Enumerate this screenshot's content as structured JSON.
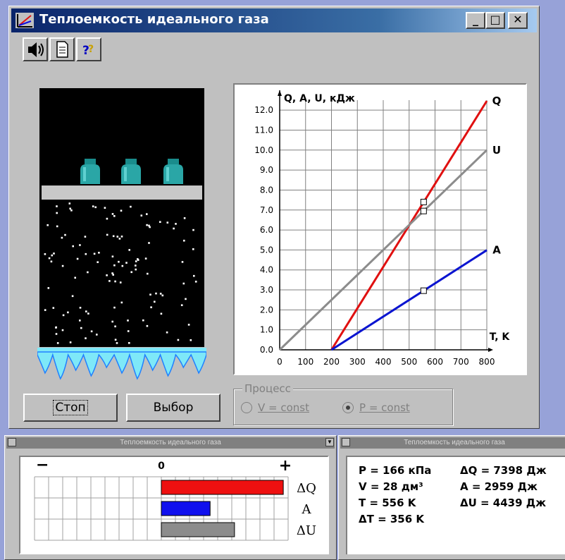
{
  "window": {
    "title": "Теплоемкость идеального газа",
    "minimize_label": "_",
    "maximize_label": "□",
    "close_label": "✕"
  },
  "toolbar": {
    "help_label": "?"
  },
  "buttons": {
    "stop_label": "Стоп",
    "select_label": "Выбор"
  },
  "process": {
    "group_label": "Процесс",
    "option_v": "V = const",
    "option_p": "P = const",
    "selected": "P = const"
  },
  "chart_data": {
    "type": "line",
    "ylabel": "Q, A, U, кДж",
    "xlabel": "T, K",
    "xlim": [
      0,
      800
    ],
    "ylim": [
      0,
      12.5
    ],
    "x_ticks": [
      "0",
      "100",
      "200",
      "300",
      "400",
      "500",
      "600",
      "700",
      "800"
    ],
    "y_ticks": [
      "0.0",
      "1.0",
      "2.0",
      "3.0",
      "4.0",
      "5.0",
      "6.0",
      "7.0",
      "8.0",
      "9.0",
      "10.0",
      "11.0",
      "12.0"
    ],
    "grid": true,
    "series": [
      {
        "name": "Q",
        "color": "#e01010",
        "points": [
          [
            200,
            0
          ],
          [
            800,
            12.46
          ]
        ]
      },
      {
        "name": "U",
        "color": "#8c8c8c",
        "points": [
          [
            0,
            0
          ],
          [
            800,
            10.0
          ]
        ]
      },
      {
        "name": "A",
        "color": "#0a14d0",
        "points": [
          [
            200,
            0
          ],
          [
            800,
            4.99
          ]
        ]
      }
    ],
    "markers": [
      {
        "series": "Q",
        "x": 556,
        "y": 7.4
      },
      {
        "series": "U",
        "x": 556,
        "y": 6.95
      },
      {
        "series": "A",
        "x": 556,
        "y": 2.96
      }
    ]
  },
  "bar_window": {
    "title": "Теплоемкость идеального газа",
    "minus_label": "−",
    "zero_label": "0",
    "plus_label": "+",
    "colors": {
      "dQ": "#ee1010",
      "A": "#1010ee",
      "dU": "#8c8c8c"
    },
    "bars": [
      {
        "label": "ΔQ",
        "value": 7398
      },
      {
        "label": "A",
        "value": 2959
      },
      {
        "label": "ΔU",
        "value": 4439
      }
    ],
    "scale_max": 10000
  },
  "stats_window": {
    "title": "Теплоемкость идеального газа",
    "rows": [
      {
        "left": "P  = 166 кПа",
        "right": "ΔQ = 7398 Дж"
      },
      {
        "left": "V  = 28 дм³",
        "right": "A   = 2959 Дж"
      },
      {
        "left": "T  = 556 K",
        "right": "ΔU = 4439 Дж"
      },
      {
        "left": "ΔT = 356 K",
        "right": ""
      }
    ]
  }
}
